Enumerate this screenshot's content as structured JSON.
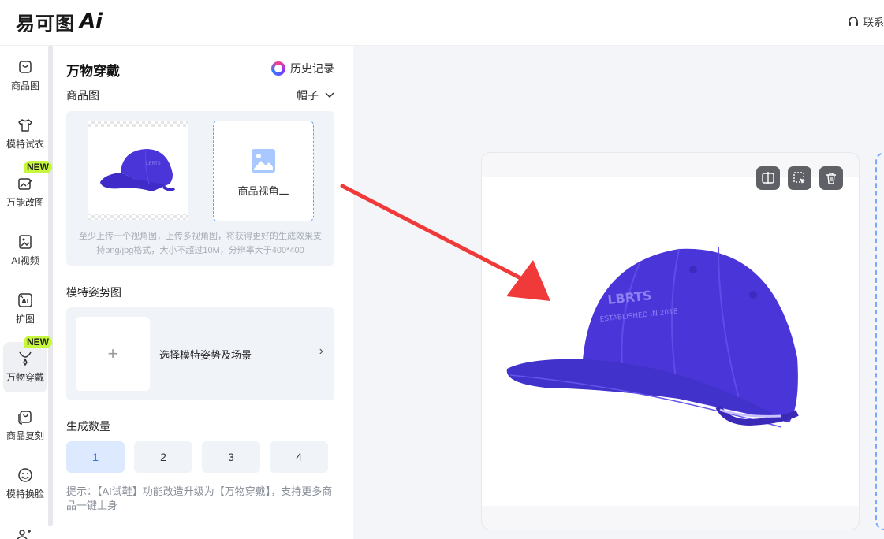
{
  "header": {
    "logo_text": "易可图",
    "logo_ai": "Ai",
    "contact_label": "联系"
  },
  "nav": {
    "items": [
      {
        "label": "商品图",
        "icon": "bag-icon"
      },
      {
        "label": "模特试衣",
        "icon": "tshirt-icon"
      },
      {
        "label": "万能改图",
        "icon": "edit-image-icon",
        "badge": "NEW"
      },
      {
        "label": "AI视频",
        "icon": "video-icon"
      },
      {
        "label": "扩图",
        "icon": "expand-icon"
      },
      {
        "label": "万物穿戴",
        "icon": "necklace-icon",
        "badge": "NEW",
        "active": true
      },
      {
        "label": "商品复刻",
        "icon": "copy-bag-icon"
      },
      {
        "label": "模特换脸",
        "icon": "face-icon"
      }
    ]
  },
  "panel": {
    "title": "万物穿戴",
    "history_label": "历史记录",
    "product_section_label": "商品图",
    "category_selected": "帽子",
    "view2_label": "商品视角二",
    "upload_tip": "至少上传一个视角图，上传多视角图，将获得更好的生成效果支持png/jpg格式，大小不超过10M，分辨率大于400*400",
    "pose_section_label": "模特姿势图",
    "pose_plus": "+",
    "pose_prompt": "选择模特姿势及场景",
    "pose_arrow": "›",
    "count_section_label": "生成数量",
    "counts": [
      "1",
      "2",
      "3",
      "4"
    ],
    "count_selected": "1",
    "hint": "提示：【AI试鞋】功能改造升级为【万物穿戴】，支持更多商品一键上身"
  },
  "canvas": {
    "tools": [
      "compare-icon",
      "select-icon",
      "delete-icon"
    ],
    "cap_print_line1": "LBRTS",
    "cap_print_line2": "ESTABLISHED IN 2018"
  },
  "colors": {
    "accent": "#2d6fe8",
    "cap": "#4a35d8",
    "badge": "#c6f73c",
    "arrow": "#f03a3a"
  }
}
